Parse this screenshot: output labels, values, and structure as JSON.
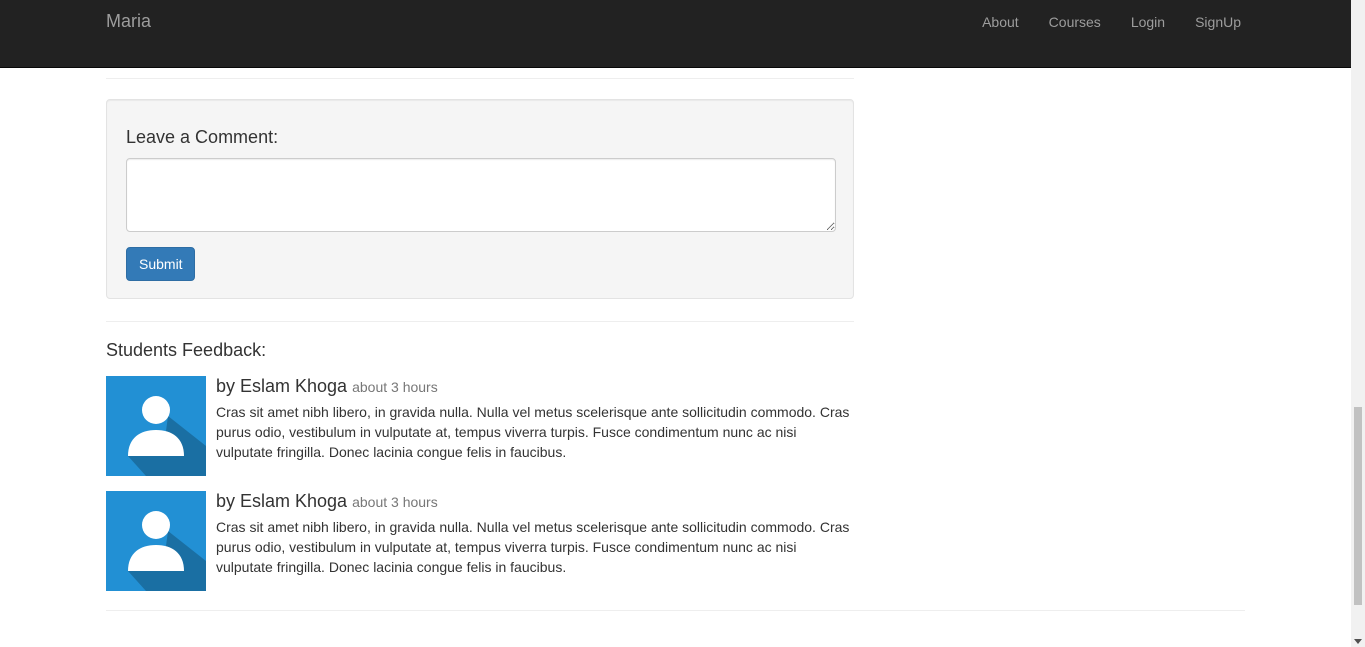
{
  "navbar": {
    "brand": "Maria",
    "links": [
      {
        "label": "About"
      },
      {
        "label": "Courses"
      },
      {
        "label": "Login"
      },
      {
        "label": "SignUp"
      }
    ]
  },
  "comment_form": {
    "title": "Leave a Comment:",
    "textarea_value": "",
    "submit_label": "Submit"
  },
  "feedback": {
    "title": "Students Feedback:",
    "items": [
      {
        "author": "by Eslam Khoga",
        "time": "about 3 hours",
        "text": "Cras sit amet nibh libero, in gravida nulla. Nulla vel metus scelerisque ante sollicitudin commodo. Cras purus odio, vestibulum in vulputate at, tempus viverra turpis. Fusce condimentum nunc ac nisi vulputate fringilla. Donec lacinia congue felis in faucibus.",
        "avatar": "user-avatar-icon"
      },
      {
        "author": "by Eslam Khoga",
        "time": "about 3 hours",
        "text": "Cras sit amet nibh libero, in gravida nulla. Nulla vel metus scelerisque ante sollicitudin commodo. Cras purus odio, vestibulum in vulputate at, tempus viverra turpis. Fusce condimentum nunc ac nisi vulputate fringilla. Donec lacinia congue felis in faucibus.",
        "avatar": "user-avatar-icon"
      }
    ]
  },
  "colors": {
    "navbar_bg": "#222222",
    "nav_text": "#9d9d9d",
    "primary_button": "#337ab7",
    "avatar_bg": "#2290d4",
    "avatar_shadow": "#1a6fa3"
  }
}
